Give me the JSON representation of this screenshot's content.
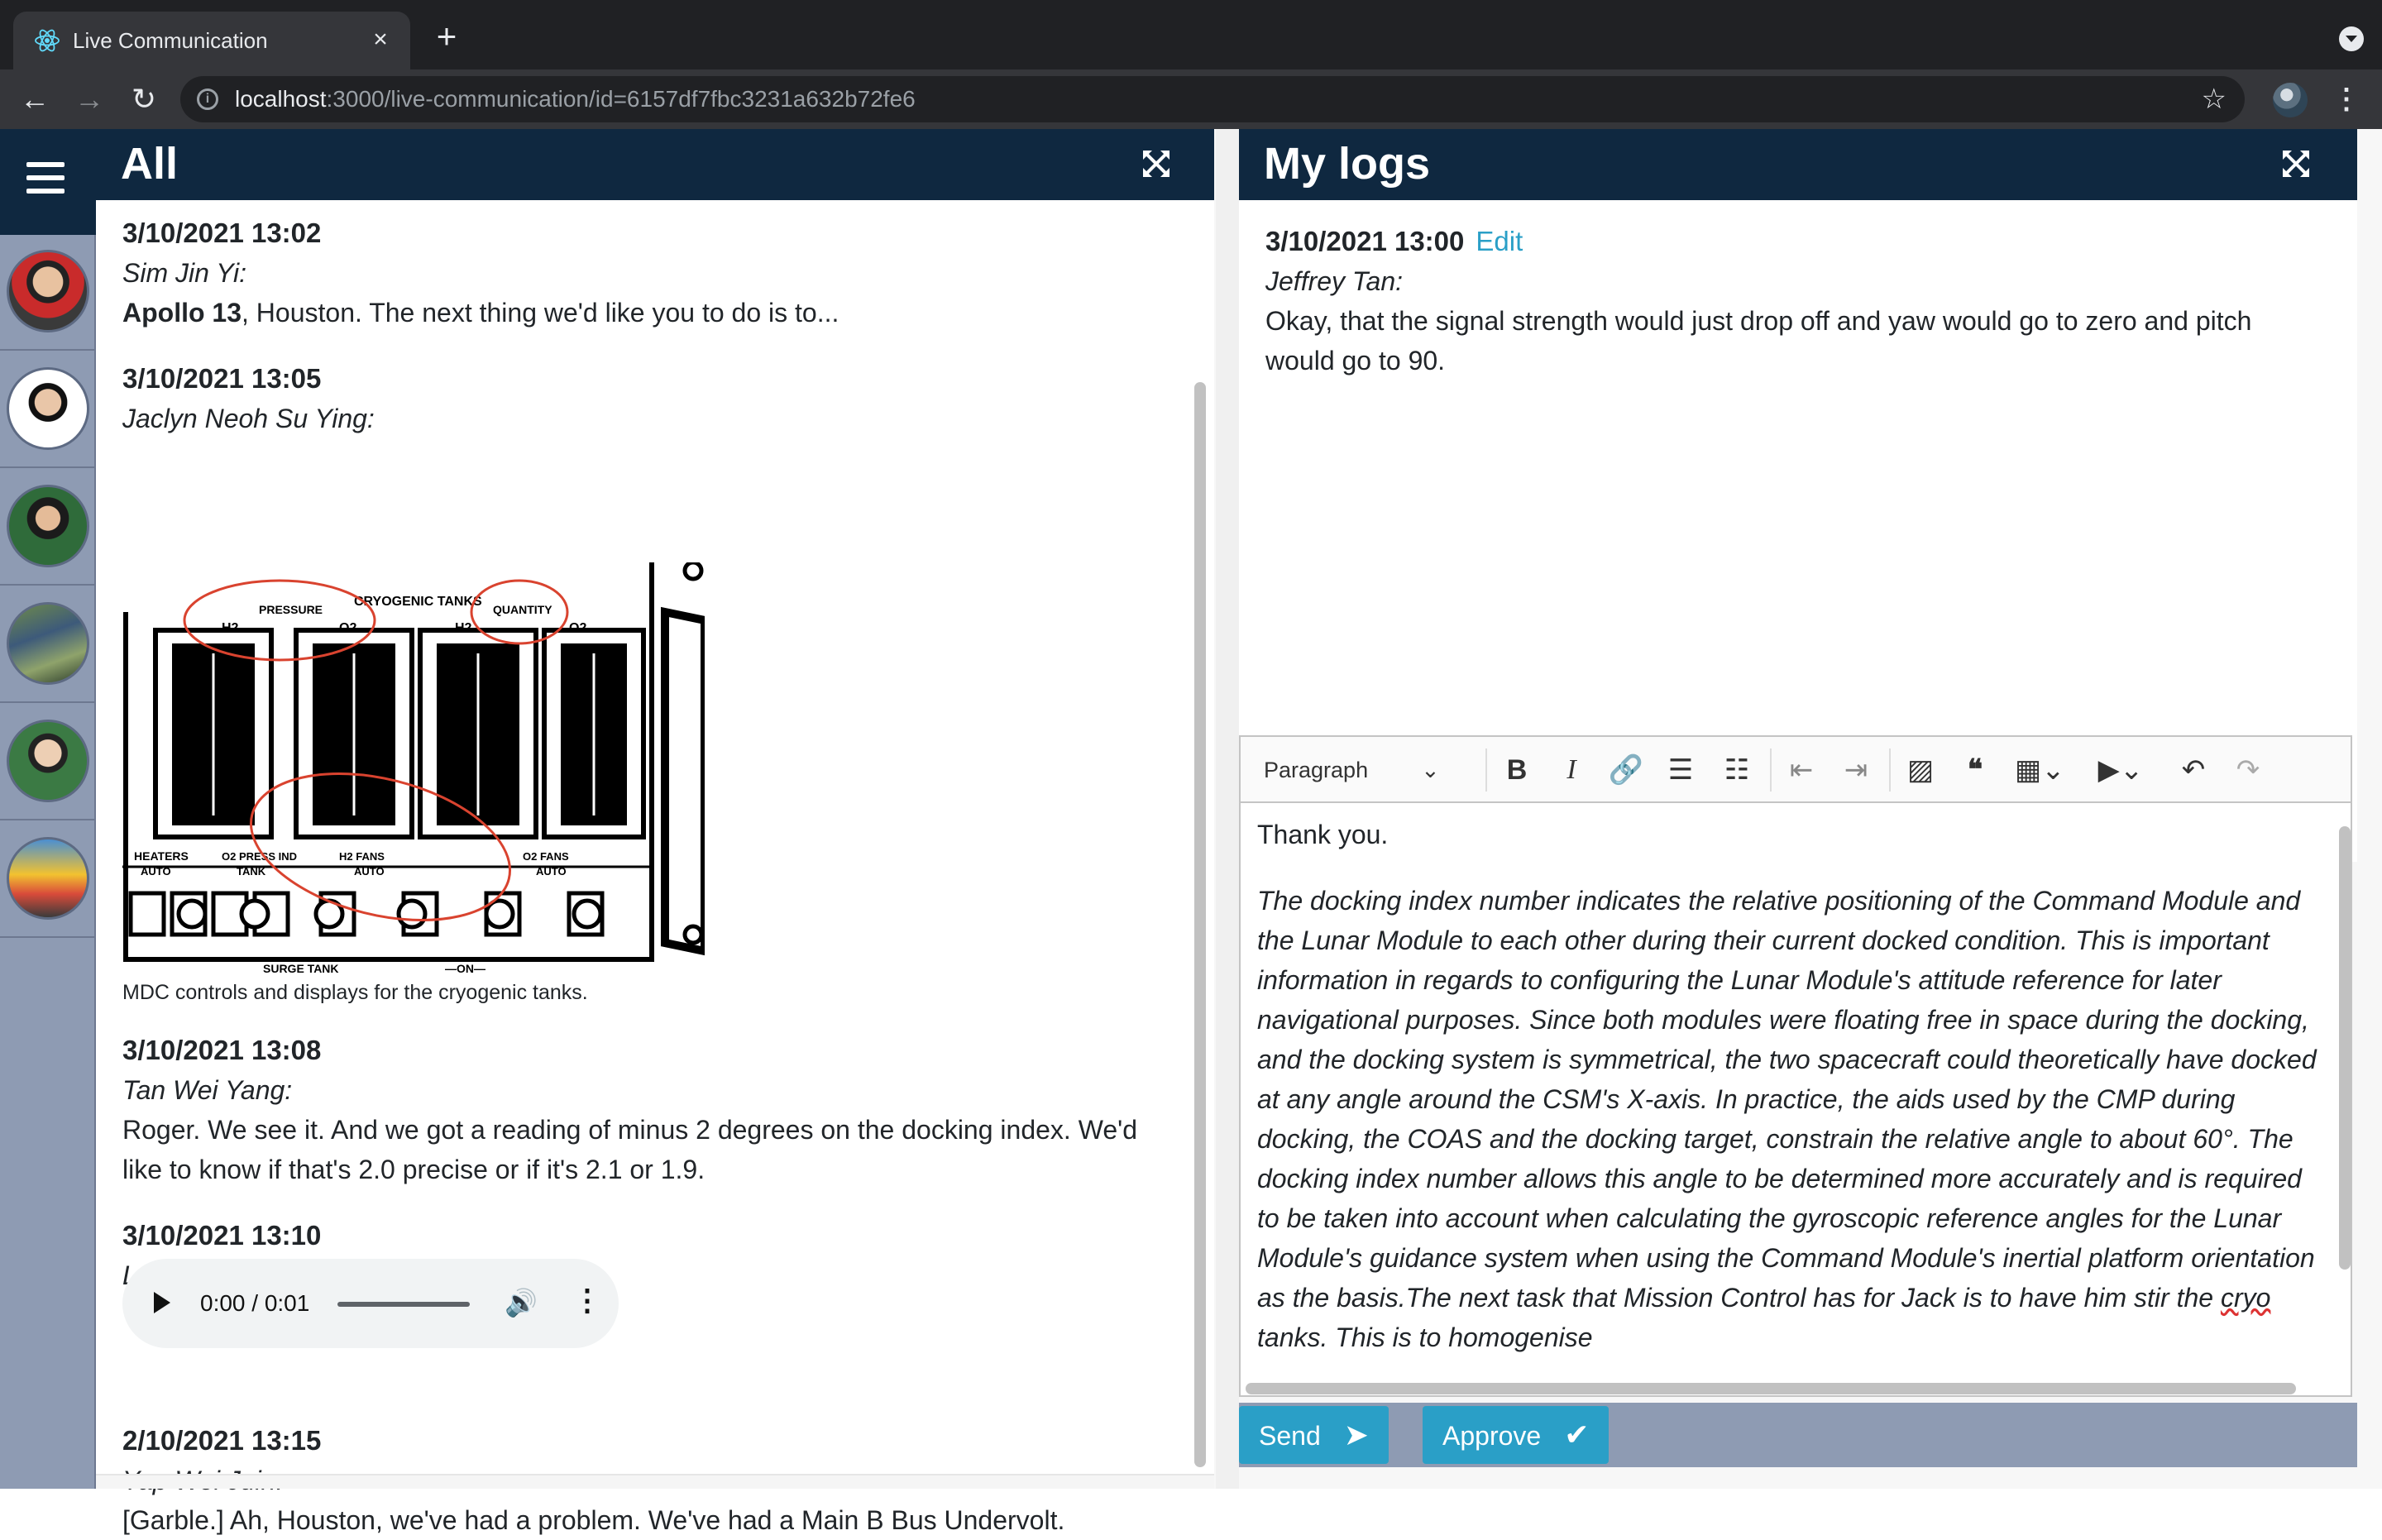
{
  "browser": {
    "tab_title": "Live Communication",
    "url_host": "localhost",
    "url_rest": ":3000/live-communication/id=6157df7fbc3231a632b72fe6"
  },
  "icons": {
    "favicon": "react-icon",
    "tab_close": "close-icon",
    "new_tab": "plus-icon",
    "back": "back-arrow-icon",
    "forward": "forward-arrow-icon",
    "reload": "reload-icon",
    "info": "info-icon",
    "bookmark": "star-icon",
    "menu": "hamburger-icon",
    "expand": "expand-icon"
  },
  "colors": {
    "header": "#0f2840",
    "sidebar": "#8e9bb3",
    "accent": "#2a9fc7"
  },
  "left_panel": {
    "title": "All",
    "messages": [
      {
        "time": "3/10/2021 13:02",
        "author": "Sim Jin Yi:",
        "bold": "Apollo 13",
        "text": ", Houston. The next thing we'd like you to do is to..."
      },
      {
        "time": "3/10/2021 13:05",
        "author": "Jaclyn Neoh Su Ying:",
        "caption": "MDC controls and displays for the cryogenic tanks."
      },
      {
        "time": "3/10/2021 13:08",
        "author": "Tan Wei Yang:",
        "text": "Roger. We see it. And we got a reading of minus 2 degrees on the docking index. We'd like to know if that's 2.0 precise or if it's 2.1 or 1.9."
      },
      {
        "time": "3/10/2021 13:10",
        "author": "Lau Kuan Sin:",
        "audio_time": "0:00 / 0:01"
      },
      {
        "time": "2/10/2021 13:15",
        "author": "Yap Wei Juin:",
        "text": "[Garble.] Ah, Houston, we've had a problem. We've had a Main B Bus Undervolt."
      }
    ],
    "figure_labels": {
      "cryo": "CRYOGENIC TANKS",
      "pressure": "PRESSURE",
      "quantity": "QUANTITY",
      "h2a": "H2",
      "o2a": "O2",
      "h2b": "H2",
      "o2b": "O2",
      "heaters": "HEATERS",
      "auto1": "AUTO",
      "press_ind": "O2 PRESS IND",
      "tank": "TANK",
      "h2fans": "H2 FANS",
      "auto2": "AUTO",
      "o2fans": "O2 FANS",
      "auto3": "AUTO",
      "surge": "SURGE TANK",
      "on": "—ON—"
    }
  },
  "right_panel": {
    "title": "My logs",
    "log": {
      "time": "3/10/2021 13:00",
      "edit_label": "Edit",
      "author": "Jeffrey Tan:",
      "text": "Okay, that the signal strength would just drop off and yaw would go to zero and pitch would go to 90."
    },
    "editor": {
      "block_format": "Paragraph",
      "para1": "Thank you.",
      "para2": "The docking index number indicates the relative positioning of the Command Module and the Lunar Module to each other during their current docked condition. This is important information in regards to configuring the Lunar Module's attitude reference for later navigational purposes. Since both modules were floating free in space during the docking, and the docking system is symmetrical, the two spacecraft could theoretically have docked at any angle around the CSM's X-axis. In practice, the aids used by the CMP during docking, the COAS and the docking target, constrain the relative angle to about 60°. The docking index number allows this angle to be determined more accurately and is required to be taken into account when calculating the gyroscopic reference angles for the Lunar Module's guidance system when using the Command Module's inertial platform orientation as the basis.The next task that Mission Control has for Jack is to have him stir the ",
      "para2_spell": "cryo",
      "para2_end": " tanks. This is to homogenise"
    },
    "send_label": "Send",
    "approve_label": "Approve"
  }
}
